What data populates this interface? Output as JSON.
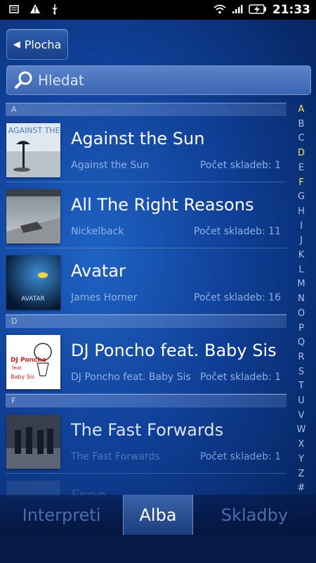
{
  "status_bar": {
    "time": "21:33",
    "icons": [
      "usb-debugging-icon",
      "warning-icon",
      "usb-icon",
      "wifi-icon",
      "signal-icon",
      "battery-charging-icon"
    ]
  },
  "header": {
    "back_label": "Plocha"
  },
  "search": {
    "placeholder": "Hledat"
  },
  "sections": {
    "a": "A",
    "d": "D",
    "f": "F"
  },
  "albums": [
    {
      "title": "Against the Sun",
      "artist": "Against the Sun",
      "count": "Počet skladeb: 1"
    },
    {
      "title": "All The Right Reasons",
      "artist": "Nickelback",
      "count": "Počet skladeb: 11"
    },
    {
      "title": "Avatar",
      "artist": "James Horner",
      "count": "Počet skladeb: 16"
    },
    {
      "title": "DJ Poncho feat. Baby Sis",
      "artist": "DJ Poncho feat. Baby Sis",
      "count": "Počet skladeb: 1"
    },
    {
      "title": "The Fast Forwards",
      "artist": "The Fast Forwards",
      "count": "Počet skladeb: 1"
    },
    {
      "title": "Free",
      "artist": "",
      "count": ""
    }
  ],
  "album_art_text": {
    "against_the_sun": "AGAINST THE SUN",
    "avatar": "AVATAR",
    "dj_poncho": "DJ Poncho",
    "dj_poncho_feat": "feat",
    "dj_poncho_baby": "Baby Sis"
  },
  "alphabet": [
    "A",
    "B",
    "C",
    "D",
    "E",
    "F",
    "G",
    "H",
    "I",
    "J",
    "K",
    "L",
    "M",
    "N",
    "O",
    "P",
    "Q",
    "R",
    "S",
    "T",
    "U",
    "V",
    "W",
    "X",
    "Y",
    "Z",
    "#"
  ],
  "alphabet_active": [
    "A",
    "D",
    "F"
  ],
  "tabs": {
    "artists": "Interpreti",
    "albums": "Alba",
    "tracks": "Skladby"
  },
  "colors": {
    "accent_yellow": "#f2e14b",
    "subtitle_blue": "#8fb0e3"
  }
}
